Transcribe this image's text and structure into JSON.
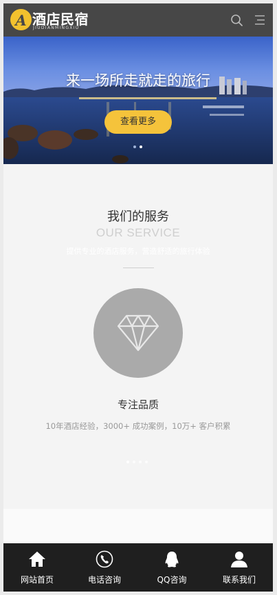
{
  "header": {
    "logo_letter": "A",
    "brand": "酒店民宿",
    "brand_sub": "JIUDIANMINGXIU",
    "icons": [
      "search-icon",
      "menu-icon"
    ]
  },
  "banner": {
    "title": "来一场所走就走的旅行",
    "button_label": "查看更多",
    "slide_count": 2,
    "active_slide": 2
  },
  "service": {
    "title": "我们的服务",
    "title_en": "OUR SERVICE",
    "description": "提供专业的酒店服务，营造舒适的旅行体验",
    "item": {
      "icon": "diamond-icon",
      "title": "专注品质",
      "description": "10年酒店经验，3000+ 成功案例，10万+ 客户积累"
    },
    "dot_count": 4
  },
  "footer": {
    "items": [
      {
        "label": "网站首页",
        "icon": "home-icon"
      },
      {
        "label": "电话咨询",
        "icon": "phone-icon"
      },
      {
        "label": "QQ咨询",
        "icon": "qq-icon"
      },
      {
        "label": "联系我们",
        "icon": "user-icon"
      }
    ]
  },
  "colors": {
    "header_bg": "#474747",
    "accent": "#f5c33b",
    "footer_bg": "#1f1f1f",
    "circle": "#aaaaaa"
  }
}
